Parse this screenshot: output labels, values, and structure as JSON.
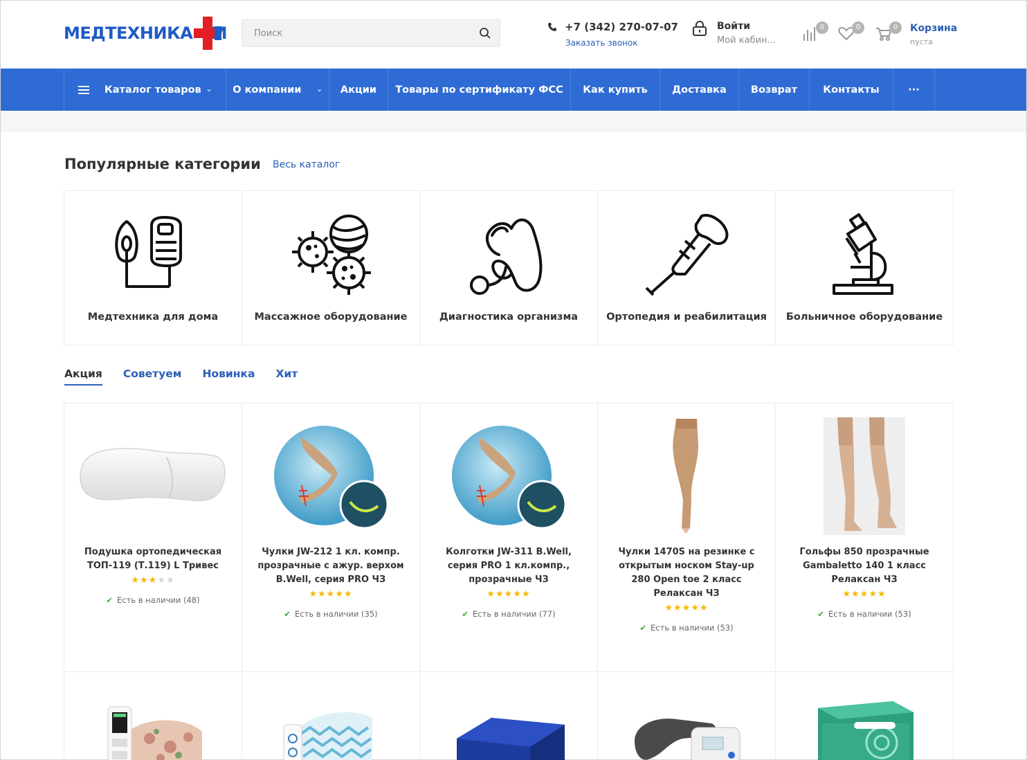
{
  "header": {
    "logo_left": "МЕДТЕХНИКА",
    "logo_right": "М",
    "search_placeholder": "Поиск",
    "phone": "+7 (342) 270-07-07",
    "callback": "Заказать звонок",
    "login_title": "Войти",
    "login_sub": "Мой кабин...",
    "compare_count": "0",
    "favorites_count": "0",
    "cart_count": "0",
    "cart_title": "Корзина",
    "cart_sub": "пуста"
  },
  "nav": {
    "catalog": "Каталог товаров",
    "about": "О компании",
    "promo": "Акции",
    "fss": "Товары по сертификату ФСС",
    "howto": "Как купить",
    "delivery": "Доставка",
    "returns": "Возврат",
    "contacts": "Контакты",
    "more": "···"
  },
  "popular": {
    "title": "Популярные категории",
    "all_link": "Весь каталог",
    "categories": [
      {
        "label": "Медтехника для дома",
        "icon": "inhaler-icon"
      },
      {
        "label": "Массажное оборудование",
        "icon": "massage-balls-icon"
      },
      {
        "label": "Диагностика организма",
        "icon": "stethoscope-icon"
      },
      {
        "label": "Ортопедия и реабилитация",
        "icon": "crutch-icon"
      },
      {
        "label": "Больничное оборудование",
        "icon": "microscope-icon"
      }
    ]
  },
  "tabs": [
    "Акция",
    "Советуем",
    "Новинка",
    "Хит"
  ],
  "products": [
    {
      "name": "Подушка ортопедическая ТОП-119 (Т.119) L Тривес",
      "rating": 3,
      "stock": "Есть в наличии (48)"
    },
    {
      "name": "Чулки JW-212 1 кл. компр. прозрачные с ажур. верхом B.Well, серия PRO ЧЗ",
      "rating": 5,
      "stock": "Есть в наличии (35)"
    },
    {
      "name": "Колготки JW-311 B.Well, серия PRO 1 кл.компр., прозрачные ЧЗ",
      "rating": 5,
      "stock": "Есть в наличии (77)"
    },
    {
      "name": "Чулки 1470S на резинке с открытым носком Stay-up 280 Open toe 2 класс Релаксан ЧЗ",
      "rating": 5,
      "stock": "Есть в наличии (53)"
    },
    {
      "name": "Гольфы 850 прозрачные Gambaletto 140 1 класс Релаксан ЧЗ",
      "rating": 5,
      "stock": "Есть в наличии (53)"
    }
  ],
  "colors": {
    "brand_blue": "#2f6bd4",
    "brand_red": "#e31e24",
    "link_blue": "#2a5fb8",
    "star": "#f5b800",
    "in_stock": "#3ca83c"
  }
}
